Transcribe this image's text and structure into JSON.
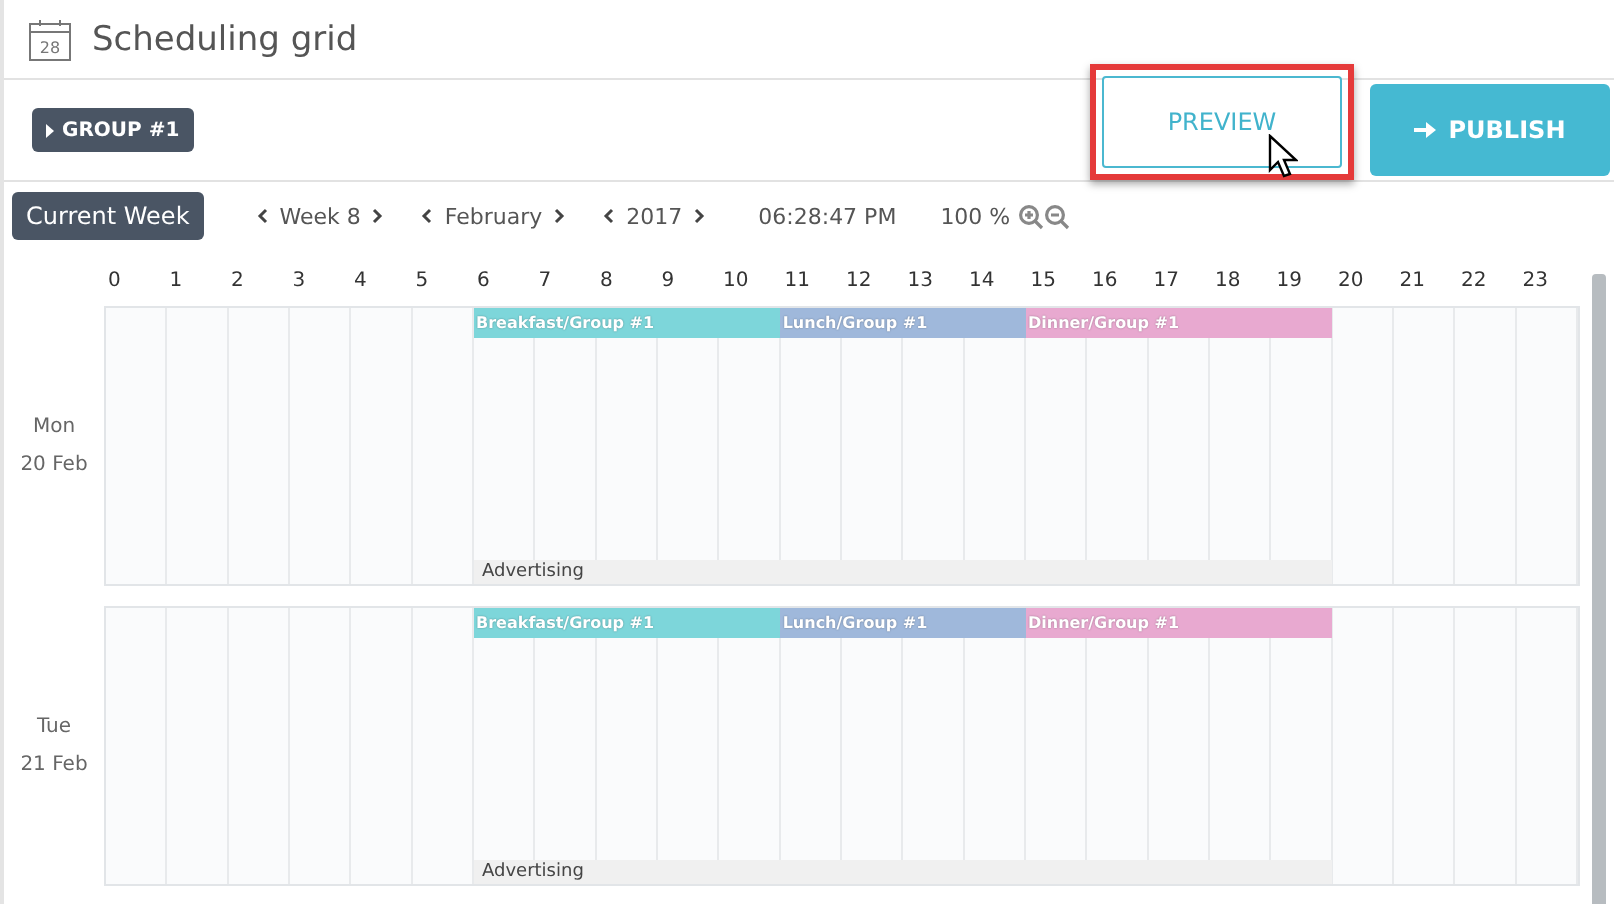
{
  "header": {
    "title": "Scheduling grid",
    "calendar_day": "28"
  },
  "toolbar": {
    "group_label": "GROUP #1",
    "preview": {
      "label": "PREVIEW",
      "highlighted": true
    },
    "publish": {
      "label": "PUBLISH"
    }
  },
  "nav": {
    "current_week": "Current Week",
    "week": "Week 8",
    "month": "February",
    "year": "2017",
    "time": "06:28:47 PM",
    "zoom": "100 %"
  },
  "hours": [
    "0",
    "1",
    "2",
    "3",
    "4",
    "5",
    "6",
    "7",
    "8",
    "9",
    "10",
    "11",
    "12",
    "13",
    "14",
    "15",
    "16",
    "17",
    "18",
    "19",
    "20",
    "21",
    "22",
    "23"
  ],
  "days": [
    {
      "weekday": "Mon",
      "date": "20 Feb",
      "events": [
        {
          "kind": "breakfast",
          "label": "Breakfast/Group #1",
          "color": "#7dd6da"
        },
        {
          "kind": "lunch",
          "label": "Lunch/Group #1",
          "color": "#9fb8db"
        },
        {
          "kind": "dinner",
          "label": "Dinner/Group #1",
          "color": "#e8a9d0"
        }
      ],
      "footer": {
        "label": "Advertising"
      }
    },
    {
      "weekday": "Tue",
      "date": "21 Feb",
      "events": [
        {
          "kind": "breakfast",
          "label": "Breakfast/Group #1",
          "color": "#7dd6da"
        },
        {
          "kind": "lunch",
          "label": "Lunch/Group #1",
          "color": "#9fb8db"
        },
        {
          "kind": "dinner",
          "label": "Dinner/Group #1",
          "color": "#e8a9d0"
        }
      ],
      "footer": {
        "label": "Advertising"
      }
    }
  ]
}
